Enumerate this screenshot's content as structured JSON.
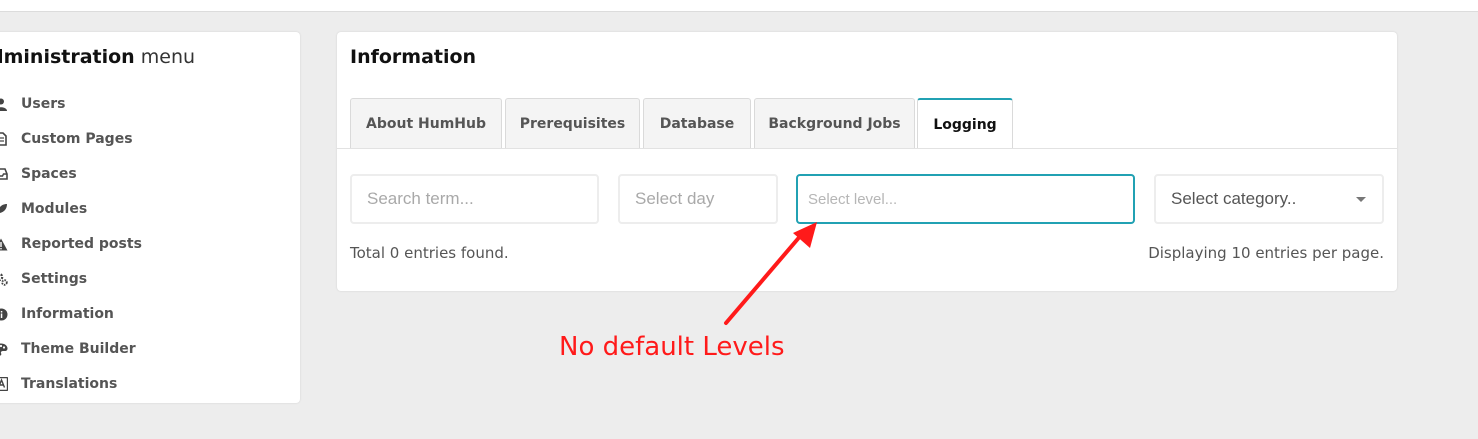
{
  "sidebar": {
    "title_bold": "dministration",
    "title_light": "menu",
    "items": [
      {
        "label": "Users",
        "icon": "user-icon"
      },
      {
        "label": "Custom Pages",
        "icon": "file-icon"
      },
      {
        "label": "Spaces",
        "icon": "inbox-icon"
      },
      {
        "label": "Modules",
        "icon": "rocket-icon"
      },
      {
        "label": "Reported posts",
        "icon": "warning-icon"
      },
      {
        "label": "Settings",
        "icon": "gears-icon"
      },
      {
        "label": "Information",
        "icon": "info-icon"
      },
      {
        "label": "Theme Builder",
        "icon": "palette-icon"
      },
      {
        "label": "Translations",
        "icon": "language-icon"
      }
    ]
  },
  "panel": {
    "title": "Information",
    "tabs": [
      {
        "label": "About HumHub"
      },
      {
        "label": "Prerequisites"
      },
      {
        "label": "Database"
      },
      {
        "label": "Background Jobs"
      },
      {
        "label": "Logging",
        "active": true
      }
    ],
    "filters": {
      "search_placeholder": "Search term...",
      "day_placeholder": "Select day",
      "level_placeholder": "Select level...",
      "category_value": "Select category.."
    },
    "total_text": "Total 0 entries found.",
    "per_page_text": "Displaying 10 entries per page."
  },
  "annotation": {
    "text": "No default Levels",
    "color": "#ff1a1a"
  },
  "colors": {
    "accent": "#21a1b3",
    "background": "#ededed"
  }
}
